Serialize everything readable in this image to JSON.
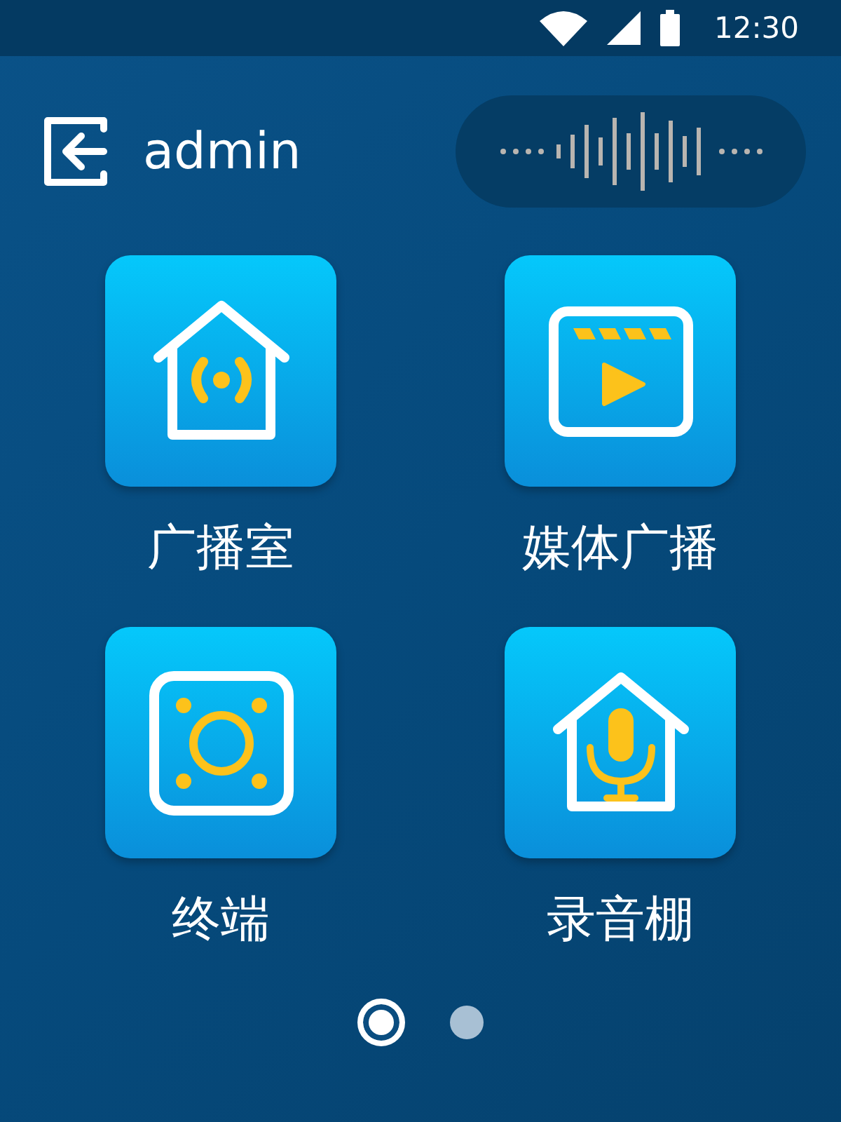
{
  "status_bar": {
    "time": "12:30"
  },
  "header": {
    "user": "admin"
  },
  "tiles": [
    {
      "kind": "broadcast",
      "label": "广播室"
    },
    {
      "kind": "media",
      "label": "媒体广播"
    },
    {
      "kind": "speaker",
      "label": "终端"
    },
    {
      "kind": "studio",
      "label": "录音棚"
    }
  ],
  "pages": [
    {
      "selected": true
    },
    {
      "selected": false
    }
  ]
}
